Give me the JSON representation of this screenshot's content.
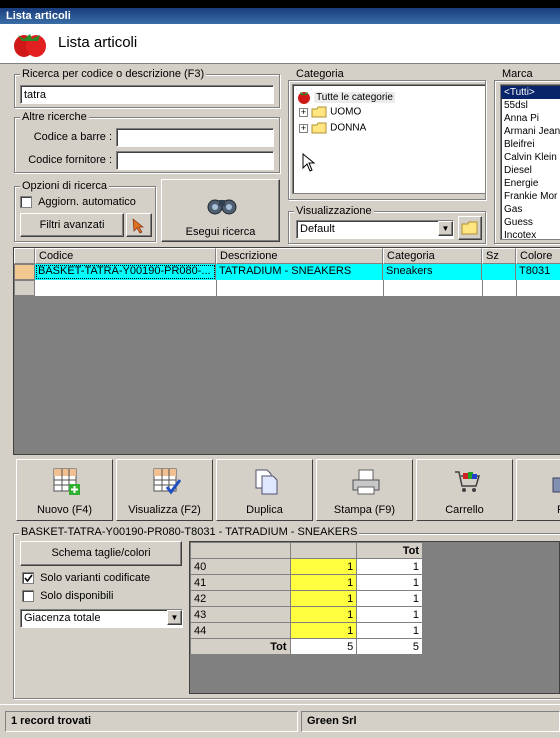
{
  "window": {
    "title": "Lista articoli"
  },
  "header": {
    "title": "Lista articoli"
  },
  "search": {
    "label": "Ricerca per codice o descrizione (F3)",
    "value": "tatra"
  },
  "other_search": {
    "label": "Altre ricerche",
    "barcode_label": "Codice a barre :",
    "barcode_value": "",
    "supplier_label": "Codice fornitore :",
    "supplier_value": ""
  },
  "options": {
    "label": "Opzioni di ricerca",
    "auto_update_label": "Aggiorn. automatico",
    "advanced_filters_label": "Filtri avanzati"
  },
  "execute_label": "Esegui ricerca",
  "category": {
    "label": "Categoria",
    "root": "Tutte le categorie",
    "children": [
      "UOMO",
      "DONNA"
    ]
  },
  "view": {
    "label": "Visualizzazione",
    "value": "Default"
  },
  "brand": {
    "label": "Marca",
    "items": [
      "<Tutti>",
      "55dsl",
      "Anna Pi",
      "Armani Jean",
      "Bleifrei",
      "Calvin Klein",
      "Diesel",
      "Energie",
      "Frankie Mor",
      "Gas",
      "Guess",
      "Incotex"
    ]
  },
  "grid": {
    "headers": [
      "Codice",
      "Descrizione",
      "Categoria",
      "Sz",
      "Colore"
    ],
    "rows": [
      [
        "BASKET-TATRA-Y00190-PR080-...",
        "TATRADIUM - SNEAKERS",
        "Sneakers",
        "",
        "T8031"
      ]
    ]
  },
  "toolbar": {
    "new_label": "Nuovo (F4)",
    "view_label": "Visualizza (F2)",
    "duplicate_label": "Duplica",
    "print_label": "Stampa (F9)",
    "cart_label": "Carrello",
    "more_label": "F"
  },
  "detail": {
    "label": "BASKET-TATRA-Y00190-PR080-T8031 - TATRADIUM - SNEAKERS",
    "schema_label": "Schema taglie/colori",
    "coded_variants_label": "Solo varianti codificate",
    "available_only_label": "Solo disponibili",
    "stock_select": "Giacenza totale"
  },
  "sizes_table": {
    "tot_header": "Tot",
    "rows": [
      {
        "size": "40",
        "qty": "1",
        "tot": "1"
      },
      {
        "size": "41",
        "qty": "1",
        "tot": "1"
      },
      {
        "size": "42",
        "qty": "1",
        "tot": "1"
      },
      {
        "size": "43",
        "qty": "1",
        "tot": "1"
      },
      {
        "size": "44",
        "qty": "1",
        "tot": "1"
      }
    ],
    "footer_label": "Tot",
    "footer_qty": "5",
    "footer_tot": "5"
  },
  "status": {
    "records": "1 record trovati",
    "company": "Green Srl"
  },
  "colors": {
    "selected_row": "#00ffff",
    "highlight_cell": "#ffff40",
    "titlebar": "#0a246a"
  }
}
